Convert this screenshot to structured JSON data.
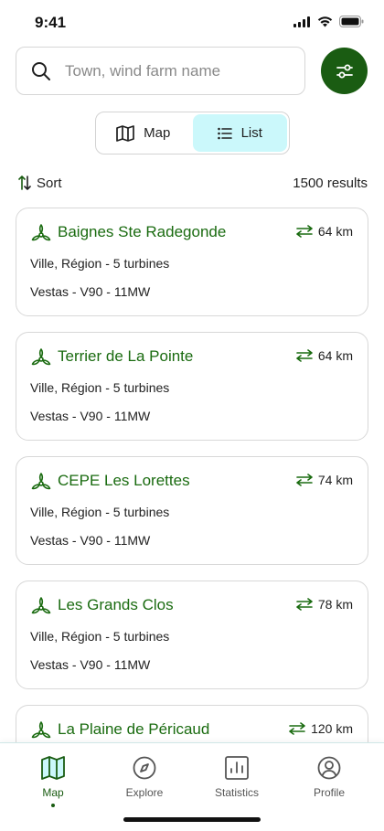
{
  "status_bar": {
    "time": "9:41"
  },
  "search": {
    "placeholder": "Town, wind farm name",
    "value": ""
  },
  "view_toggle": {
    "map_label": "Map",
    "list_label": "List",
    "active": "List"
  },
  "sort": {
    "label": "Sort",
    "results": "1500 results"
  },
  "farms": [
    {
      "name": "Baignes Ste Radegonde",
      "distance": "64 km",
      "location": "Ville, Région - 5 turbines",
      "model": "Vestas - V90 - 11MW"
    },
    {
      "name": "Terrier de La Pointe",
      "distance": "64 km",
      "location": "Ville, Région - 5 turbines",
      "model": "Vestas - V90 - 11MW"
    },
    {
      "name": "CEPE Les Lorettes",
      "distance": "74 km",
      "location": "Ville, Région - 5 turbines",
      "model": "Vestas - V90 - 11MW"
    },
    {
      "name": "Les Grands Clos",
      "distance": "78 km",
      "location": "Ville, Région - 5 turbines",
      "model": "Vestas - V90 - 11MW"
    },
    {
      "name": "La Plaine de Péricaud",
      "distance": "120 km",
      "location": "",
      "model": ""
    }
  ],
  "nav": {
    "items": [
      {
        "label": "Map",
        "icon": "map-icon",
        "active": true
      },
      {
        "label": "Explore",
        "icon": "compass-icon",
        "active": false
      },
      {
        "label": "Statistics",
        "icon": "statistics-icon",
        "active": false
      },
      {
        "label": "Profile",
        "icon": "profile-icon",
        "active": false
      }
    ]
  },
  "colors": {
    "brand_green": "#1a5c12",
    "name_green": "#1a6b10",
    "active_tab": "#cbf8fb"
  }
}
